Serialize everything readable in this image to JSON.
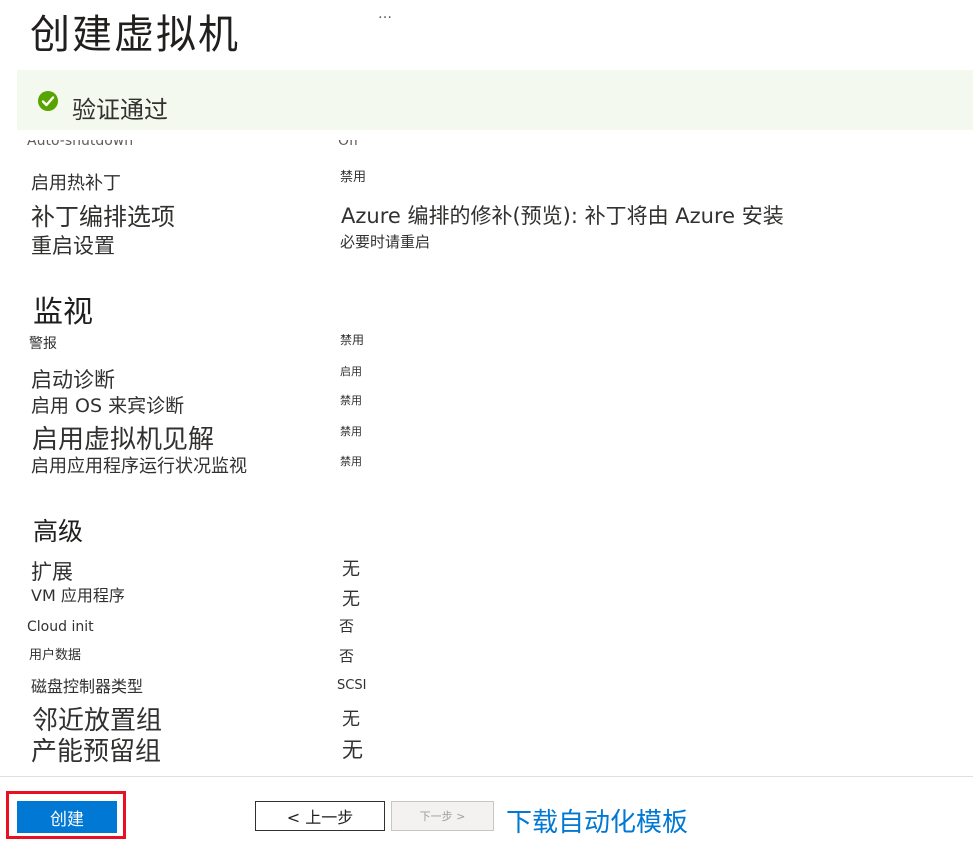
{
  "header": {
    "title": "创建虚拟机",
    "more_icon": "…"
  },
  "validation": {
    "icon": "check-circle-icon",
    "text": "验证通过",
    "color": "#57a300"
  },
  "management": {
    "cut_label": "Auto-shutdown",
    "cut_value": "Off",
    "rows": [
      {
        "label": "启用热补丁",
        "value": "禁用"
      },
      {
        "label": "补丁编排选项",
        "value": "Azure 编排的修补(预览): 补丁将由 Azure 安装"
      },
      {
        "label": "重启设置",
        "value": "必要时请重启"
      }
    ]
  },
  "monitoring": {
    "heading": "监视",
    "rows": [
      {
        "label": "警报",
        "value": "禁用"
      },
      {
        "label": "启动诊断",
        "value": "启用"
      },
      {
        "label": "启用 OS 来宾诊断",
        "value": "禁用"
      },
      {
        "label": "启用虚拟机见解",
        "value": "禁用"
      },
      {
        "label": "启用应用程序运行状况监视",
        "value": "禁用"
      }
    ]
  },
  "advanced": {
    "heading": "高级",
    "rows": [
      {
        "label": "扩展",
        "value": "无"
      },
      {
        "label": "VM 应用程序",
        "value": "无"
      },
      {
        "label": "Cloud init",
        "value": "否"
      },
      {
        "label": "用户数据",
        "value": "否"
      },
      {
        "label": "磁盘控制器类型",
        "value": "SCSI"
      },
      {
        "label": "邻近放置组",
        "value": "无"
      },
      {
        "label": "产能预留组",
        "value": "无"
      }
    ]
  },
  "footer": {
    "create_label": "创建",
    "prev_label": "< 上一步",
    "next_label": "下一步 >",
    "download_label": "下载自动化模板",
    "accent": "#0078d4",
    "highlight": "#e81123"
  }
}
